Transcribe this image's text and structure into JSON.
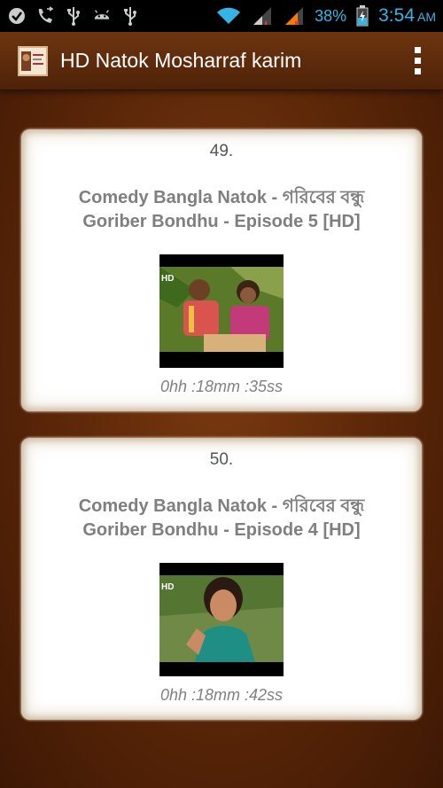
{
  "status_bar": {
    "battery_percent": "38%",
    "time": "3:54",
    "ampm": "AM",
    "icons": [
      "checkmark-icon",
      "call-forward-icon",
      "usb-icon",
      "android-icon",
      "usb-icon",
      "wifi-icon",
      "signal-icon",
      "signal-icon",
      "battery-icon"
    ]
  },
  "action_bar": {
    "title": "HD Natok Mosharraf karim",
    "menu_icon": "overflow-menu-icon"
  },
  "videos": [
    {
      "number": "49.",
      "title_line1": "Comedy Bangla Natok - গরিবের বন্ধু",
      "title_line2": "Goriber Bondhu - Episode 5 [HD]",
      "duration": "0hh :18mm :35ss"
    },
    {
      "number": "50.",
      "title_line1": "Comedy Bangla Natok - গরিবের বন্ধু",
      "title_line2": "Goriber Bondhu - Episode 4 [HD]",
      "duration": "0hh :18mm :42ss"
    }
  ],
  "colors": {
    "accent": "#35b5e5",
    "background": "#5a2608",
    "card_text": "#7f7f7f"
  }
}
